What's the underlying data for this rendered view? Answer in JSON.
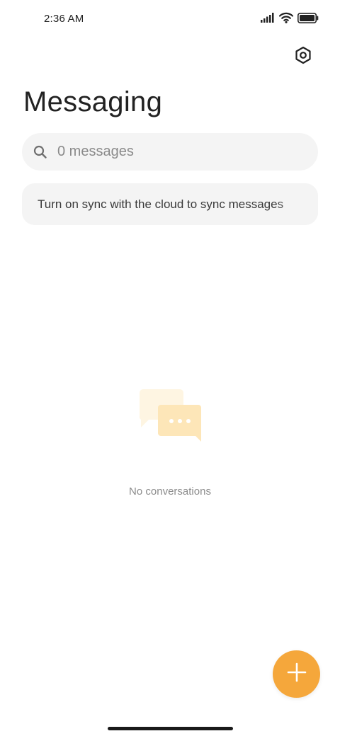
{
  "status_bar": {
    "time": "2:36 AM",
    "icons": [
      "signal-icon",
      "wifi-icon",
      "battery-icon"
    ]
  },
  "header": {
    "title": "Messaging",
    "settings_icon": "settings-icon"
  },
  "search": {
    "placeholder": "0 messages",
    "icon": "search-icon"
  },
  "sync_banner": {
    "text": "Turn on sync with the cloud to sync messages"
  },
  "empty_state": {
    "icon": "chat-bubbles-icon",
    "text": "No conversations"
  },
  "fab": {
    "icon": "plus-icon"
  },
  "colors": {
    "accent": "#f5a73b",
    "surface": "#f4f4f4",
    "illustration_light": "#fef5e2",
    "illustration_main": "#fde6b8"
  }
}
